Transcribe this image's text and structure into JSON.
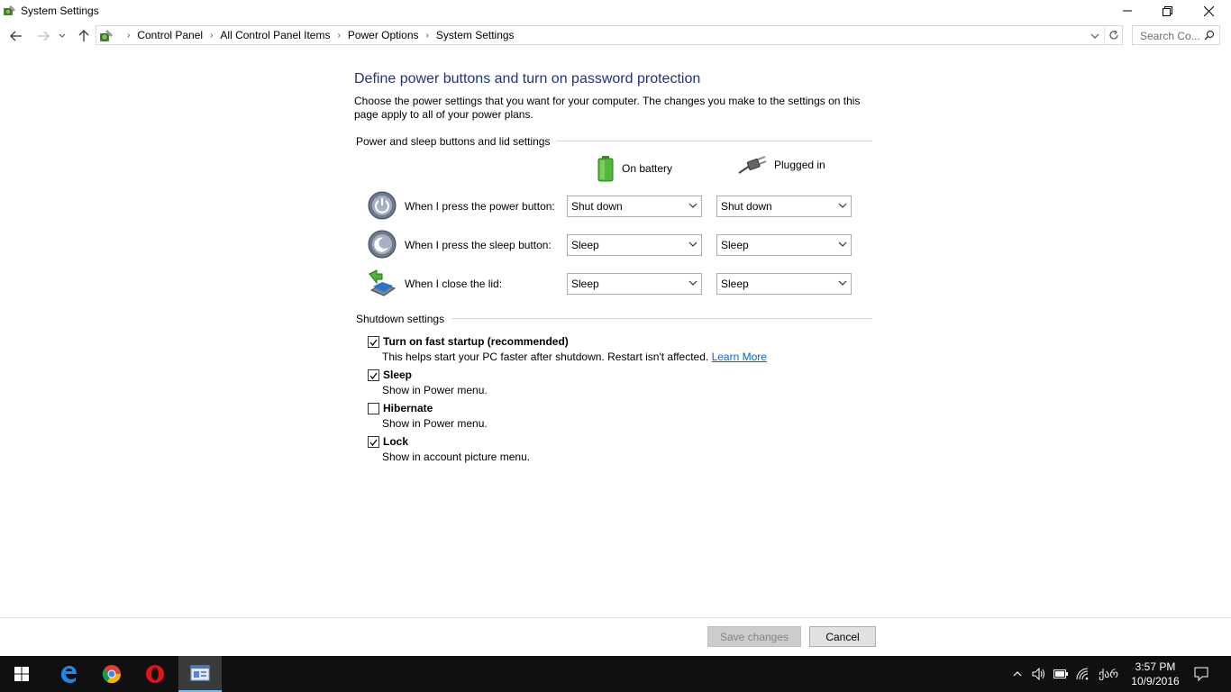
{
  "window": {
    "title": "System Settings",
    "minimize_icon": "minimize-icon",
    "restore_icon": "restore-icon",
    "close_icon": "close-icon"
  },
  "address": {
    "breadcrumbs": [
      "Control Panel",
      "All Control Panel Items",
      "Power Options",
      "System Settings"
    ],
    "search_placeholder": "Search Co..."
  },
  "main": {
    "heading": "Define power buttons and turn on password protection",
    "intro": "Choose the power settings that you want for your computer. The changes you make to the settings on this page apply to all of your power plans.",
    "buttons_section": "Power and sleep buttons and lid settings",
    "col_battery": "On battery",
    "col_plugged": "Plugged in",
    "rows": [
      {
        "label": "When I press the power button:",
        "battery": "Shut down",
        "plugged": "Shut down",
        "icon": "power-button-icon"
      },
      {
        "label": "When I press the sleep button:",
        "battery": "Sleep",
        "plugged": "Sleep",
        "icon": "sleep-button-icon"
      },
      {
        "label": "When I close the lid:",
        "battery": "Sleep",
        "plugged": "Sleep",
        "icon": "laptop-lid-icon"
      }
    ],
    "shutdown_section": "Shutdown settings",
    "options": [
      {
        "label": "Turn on fast startup (recommended)",
        "desc": "This helps start your PC faster after shutdown. Restart isn't affected.",
        "link": "Learn More",
        "checked": true
      },
      {
        "label": "Sleep",
        "desc": "Show in Power menu.",
        "checked": true
      },
      {
        "label": "Hibernate",
        "desc": "Show in Power menu.",
        "checked": false
      },
      {
        "label": "Lock",
        "desc": "Show in account picture menu.",
        "checked": true
      }
    ]
  },
  "footer": {
    "save": "Save changes",
    "cancel": "Cancel"
  },
  "taskbar": {
    "time": "3:57 PM",
    "date": "10/9/2016",
    "lang": "ქარ",
    "accent": "#76b9ed"
  }
}
